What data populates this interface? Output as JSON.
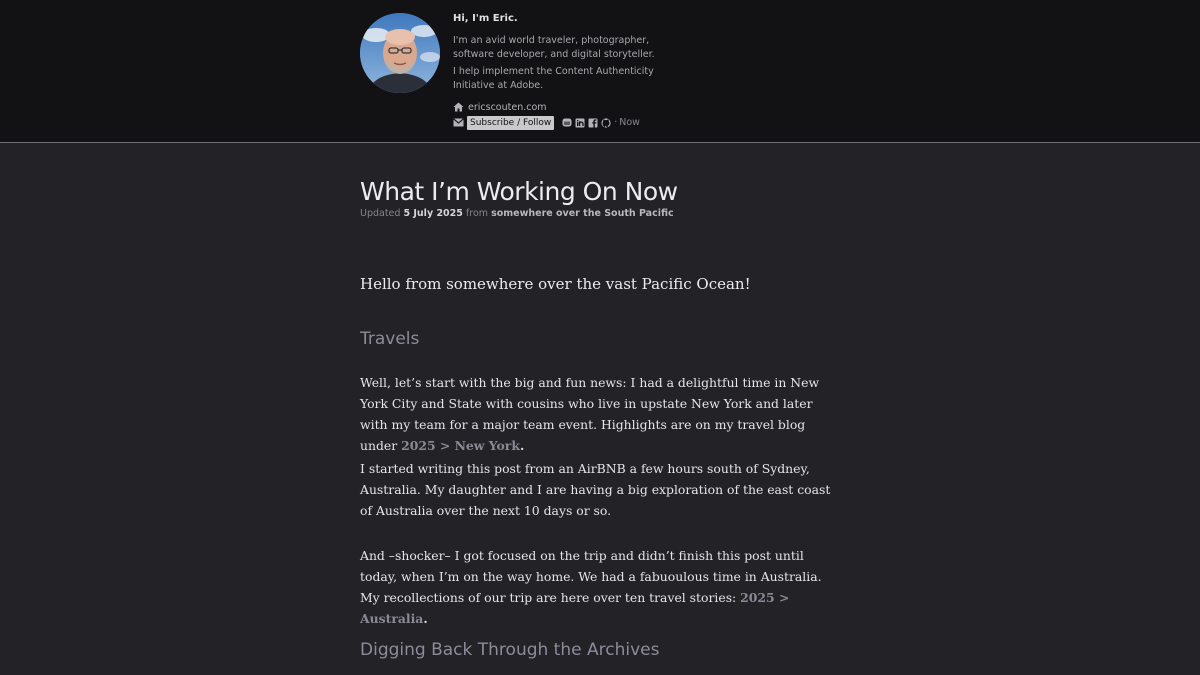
{
  "profile": {
    "greeting": "Hi, I'm Eric.",
    "bio_1": "I'm an avid world traveler, photographer, software developer, and digital storyteller.",
    "bio_2": "I help implement the Content Authenticity Initiative at Adobe.",
    "site": "ericscouten.com",
    "subscribe_label": "Subscribe / Follow",
    "now_label": "Now",
    "separator": "·"
  },
  "icons": {
    "home": "home-icon",
    "mail": "envelope-icon",
    "social": [
      "mastodon-icon",
      "linkedin-icon",
      "facebook-icon",
      "github-icon"
    ]
  },
  "post": {
    "title": "What I’m Working On Now",
    "updated_label": "Updated",
    "date": "5 July 2025",
    "from_label": "from",
    "location": "somewhere over the South Pacific",
    "intro": "Hello from somewhere over the vast Pacific Ocean!",
    "heading_travels": "Travels",
    "p1_text": "Well, let’s start with the big and fun news: I had a delightful time in New York City and State with cousins who live in upstate New York and later with my team for a major team event. Highlights are on my travel blog under ",
    "p1_link": "2025 > New York",
    "p2_text": "I started writing this post from an AirBNB a few hours south of Sydney, Australia. My daughter and I are having a big exploration of the east coast of Australia over the next 10 days or so.",
    "p3_text": "And –shocker– I got focused on the trip and didn’t finish this post until today, when I’m on the way home. We had a fabuoulous time in Australia. My recollections of our trip are here over ten travel stories: ",
    "p3_link": "2025 > Australia",
    "period": ".",
    "heading_archives": "Digging Back Through the Archives"
  },
  "colors": {
    "header_bg": "#121214",
    "page_bg": "#232227",
    "link": "#8a8a96",
    "heading": "#8c8c9a"
  }
}
